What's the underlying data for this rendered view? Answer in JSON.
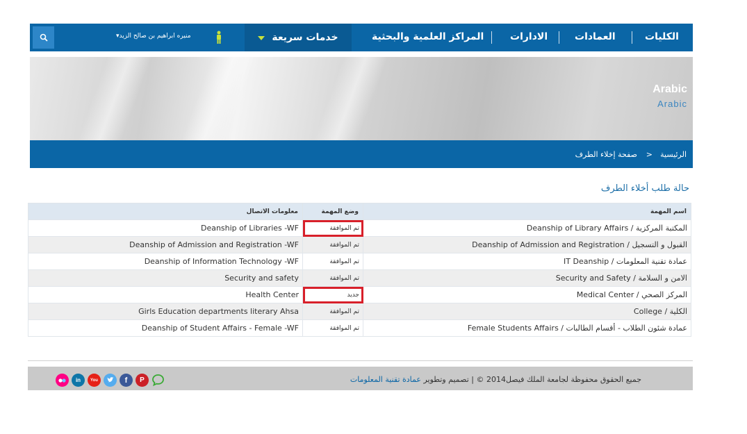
{
  "nav": {
    "menu": [
      "الكليات",
      "العمادات",
      "الادارات",
      "المراكز العلمية والبحثية"
    ],
    "quick_services": "خدمات سريعة",
    "user_name": "منيره ابراهيم بن صالح الزيد"
  },
  "banner": {
    "title_main": "Arabic",
    "title_sub": "Arabic"
  },
  "breadcrumb": {
    "home": "الرئيسية",
    "separator": ">",
    "current": "صفحة إخلاء الطرف"
  },
  "page": {
    "title": "حالة طلب أخلاء الطرف"
  },
  "table": {
    "headers": {
      "task": "اسم المهمة",
      "status": "وضع المهمة",
      "contact": "معلومات الاتصال"
    },
    "rows": [
      {
        "task": "Deanship of Library Affairs / المكتبة المركزية",
        "status": "تم الموافقة",
        "contact": "Deanship of Libraries -WF",
        "highlight": true
      },
      {
        "task": "Deanship of Admission and Registration / القبول و التسجيل",
        "status": "تم الموافقة",
        "contact": "Deanship of Admission and Registration -WF",
        "highlight": false
      },
      {
        "task": "IT Deanship / عمادة تقنية المعلومات",
        "status": "تم الموافقة",
        "contact": "Deanship of Information Technology -WF",
        "highlight": false
      },
      {
        "task": "Security and Safety / الامن و السلامة",
        "status": "تم الموافقة",
        "contact": "Security and safety",
        "highlight": false
      },
      {
        "task": "Medical Center / المركز الصحي",
        "status": "جديد",
        "contact": "Health Center",
        "highlight": true
      },
      {
        "task": "College / الكلية",
        "status": "تم الموافقة",
        "contact": "Girls Education departments literary Ahsa",
        "highlight": false
      },
      {
        "task": "Female Students Affairs / عمادة شئون الطلاب - أقسام الطالبات",
        "status": "تم الموافقة",
        "contact": "Deanship of Student Affairs - Female -WF",
        "highlight": false
      }
    ]
  },
  "footer": {
    "copyright": "جميع الحقوق محفوظة لجامعة الملك فيصل2014 © | تصميم وتطوير",
    "link_text": "عمادة تقنية المعلومات",
    "socials": [
      {
        "name": "flickr",
        "color": "#ff0084",
        "glyph": "●●"
      },
      {
        "name": "linkedin",
        "color": "#0e76a8",
        "glyph": "in"
      },
      {
        "name": "youtube",
        "color": "#e62117",
        "glyph": "You"
      },
      {
        "name": "twitter",
        "color": "#55acee",
        "glyph": "t"
      },
      {
        "name": "facebook",
        "color": "#3b5998",
        "glyph": "f"
      },
      {
        "name": "pinterest",
        "color": "#cb2027",
        "glyph": "P"
      },
      {
        "name": "chat",
        "color": "#3aaa35",
        "glyph": ""
      }
    ]
  },
  "colors": {
    "primary": "#0b66a6",
    "highlight": "#d8202a"
  }
}
